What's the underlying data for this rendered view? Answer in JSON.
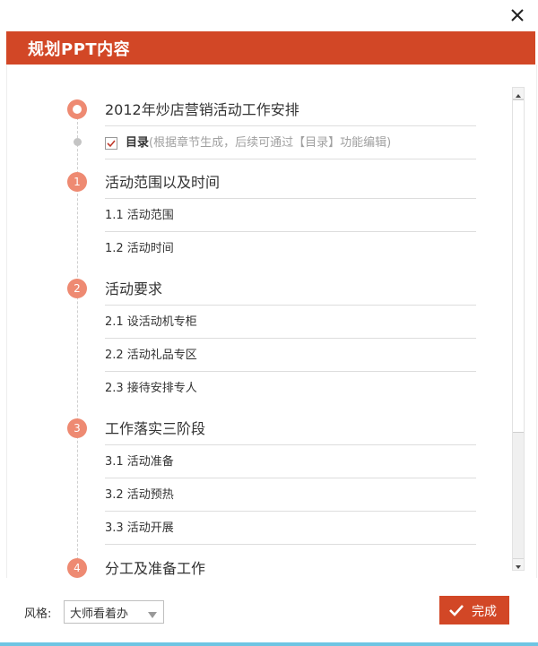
{
  "dialog": {
    "title": "规划PPT内容",
    "close_icon": "close-icon"
  },
  "outline": {
    "cover_title": "2012年炒店营销活动工作安排",
    "toc": {
      "checked": true,
      "label": "目录",
      "hint": "(根据章节生成，后续可通过【目录】功能编辑)"
    },
    "sections": [
      {
        "number": "1",
        "title": "活动范围以及时间",
        "items": [
          "1.1 活动范围",
          "1.2 活动时间"
        ]
      },
      {
        "number": "2",
        "title": "活动要求",
        "items": [
          "2.1 设活动机专柜",
          "2.2 活动礼品专区",
          "2.3 接待安排专人"
        ]
      },
      {
        "number": "3",
        "title": "工作落实三阶段",
        "items": [
          "3.1 活动准备",
          "3.2 活动预热",
          "3.3 活动开展"
        ]
      },
      {
        "number": "4",
        "title": "分工及准备工作",
        "items": []
      }
    ]
  },
  "footer": {
    "style_label": "风格:",
    "style_value": "大师看着办",
    "done_label": "完成"
  },
  "colors": {
    "accent": "#d24726",
    "marker": "#ee8a72"
  }
}
